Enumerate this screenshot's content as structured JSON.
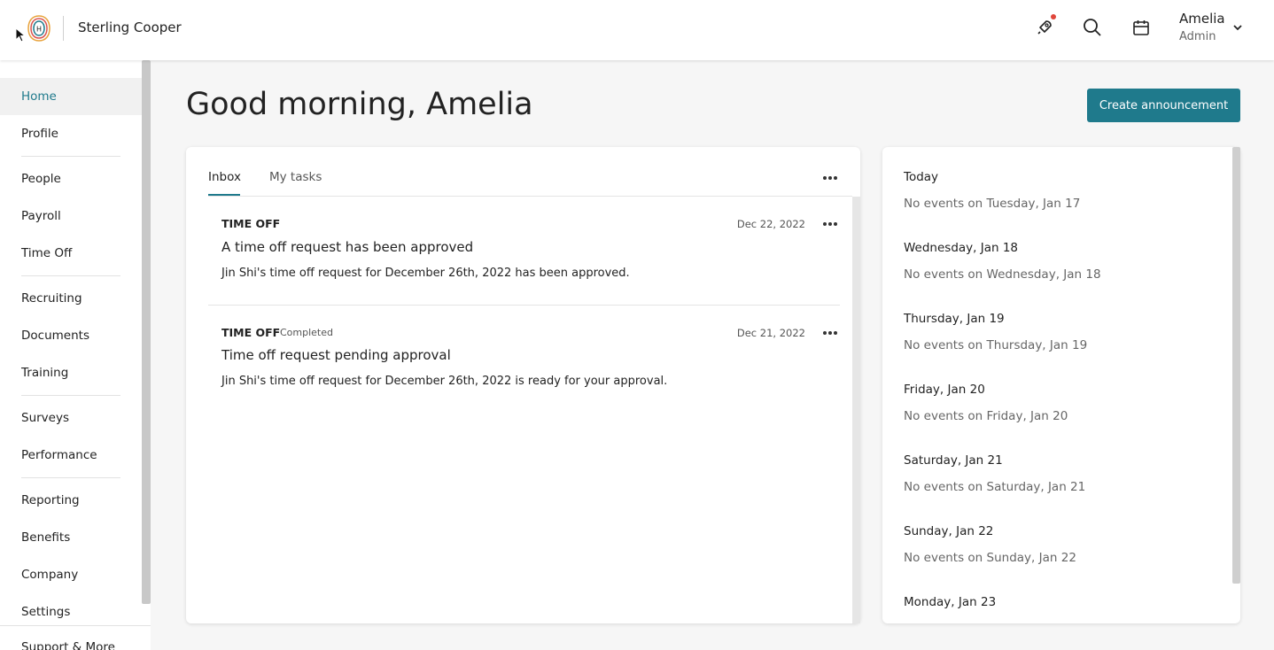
{
  "header": {
    "company": "Sterling Cooper",
    "user_name": "Amelia",
    "user_role": "Admin",
    "icons": [
      "rocket-icon",
      "search-icon",
      "calendar-icon",
      "chevron-down-icon"
    ],
    "accent_color": "#1f7a8c",
    "notification_color": "#e0463b"
  },
  "sidebar": {
    "items": [
      {
        "label": "Home",
        "active": true
      },
      {
        "label": "Profile"
      },
      {
        "label": "People"
      },
      {
        "label": "Payroll"
      },
      {
        "label": "Time Off"
      },
      {
        "label": "Recruiting"
      },
      {
        "label": "Documents"
      },
      {
        "label": "Training"
      },
      {
        "label": "Surveys"
      },
      {
        "label": "Performance"
      },
      {
        "label": "Reporting"
      },
      {
        "label": "Benefits"
      },
      {
        "label": "Company"
      },
      {
        "label": "Settings"
      }
    ],
    "footer_label": "Support & More"
  },
  "main": {
    "greeting": "Good morning, Amelia",
    "create_button": "Create announcement",
    "tabs": [
      {
        "label": "Inbox",
        "active": true
      },
      {
        "label": "My tasks"
      }
    ],
    "inbox": [
      {
        "category": "TIME OFF",
        "status": "",
        "date": "Dec 22, 2022",
        "title": "A time off request has been approved",
        "description": "Jin Shi's time off request for December 26th, 2022 has been approved."
      },
      {
        "category": "TIME OFF",
        "status": "Completed",
        "date": "Dec 21, 2022",
        "title": "Time off request pending approval",
        "description": "Jin Shi's time off request for December 26th, 2022 is ready for your approval."
      }
    ]
  },
  "events": [
    {
      "day": "Today",
      "empty": "No events on Tuesday, Jan 17"
    },
    {
      "day": "Wednesday, Jan 18",
      "empty": "No events on Wednesday, Jan 18"
    },
    {
      "day": "Thursday, Jan 19",
      "empty": "No events on Thursday, Jan 19"
    },
    {
      "day": "Friday, Jan 20",
      "empty": "No events on Friday, Jan 20"
    },
    {
      "day": "Saturday, Jan 21",
      "empty": "No events on Saturday, Jan 21"
    },
    {
      "day": "Sunday, Jan 22",
      "empty": "No events on Sunday, Jan 22"
    },
    {
      "day": "Monday, Jan 23",
      "empty": ""
    }
  ]
}
